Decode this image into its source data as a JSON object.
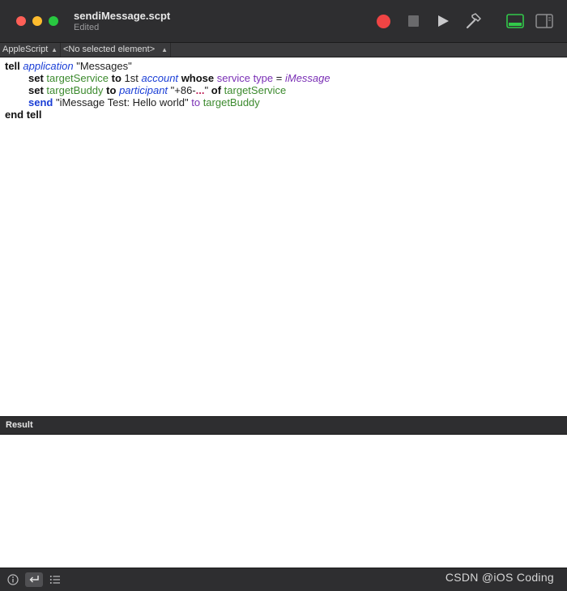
{
  "window": {
    "title": "sendiMessage.scpt",
    "subtitle": "Edited"
  },
  "toolbar": {
    "record_icon": "record-icon",
    "stop_icon": "stop-icon",
    "run_icon": "play-icon",
    "compile_icon": "hammer-icon",
    "log_icon": "log-panel-icon",
    "inspector_icon": "sidebar-icon",
    "accent": "#28c840",
    "record_color": "#ef4444"
  },
  "navbar": {
    "language": "AppleScript",
    "element": "<No selected element>"
  },
  "code": {
    "lines": [
      {
        "indent": false,
        "tokens": [
          {
            "text": "tell",
            "cls": "kw"
          },
          {
            "text": " ",
            "cls": "plain"
          },
          {
            "text": "application",
            "cls": "class"
          },
          {
            "text": " ",
            "cls": "plain"
          },
          {
            "text": "\"Messages\"",
            "cls": "str"
          }
        ]
      },
      {
        "indent": true,
        "tokens": [
          {
            "text": "set",
            "cls": "kw"
          },
          {
            "text": " ",
            "cls": "plain"
          },
          {
            "text": "targetService",
            "cls": "var"
          },
          {
            "text": " ",
            "cls": "plain"
          },
          {
            "text": "to",
            "cls": "kw"
          },
          {
            "text": " ",
            "cls": "plain"
          },
          {
            "text": "1st",
            "cls": "num"
          },
          {
            "text": " ",
            "cls": "plain"
          },
          {
            "text": "account",
            "cls": "class"
          },
          {
            "text": " ",
            "cls": "plain"
          },
          {
            "text": "whose",
            "cls": "kw"
          },
          {
            "text": " ",
            "cls": "plain"
          },
          {
            "text": "service type",
            "cls": "prop"
          },
          {
            "text": " = ",
            "cls": "plain"
          },
          {
            "text": "iMessage",
            "cls": "enum"
          }
        ]
      },
      {
        "indent": true,
        "tokens": [
          {
            "text": "set",
            "cls": "kw"
          },
          {
            "text": " ",
            "cls": "plain"
          },
          {
            "text": "targetBuddy",
            "cls": "var"
          },
          {
            "text": " ",
            "cls": "plain"
          },
          {
            "text": "to",
            "cls": "kw"
          },
          {
            "text": " ",
            "cls": "plain"
          },
          {
            "text": "participant",
            "cls": "class"
          },
          {
            "text": " ",
            "cls": "plain"
          },
          {
            "text": "\"+86-",
            "cls": "str"
          },
          {
            "text": "...",
            "cls": "hl"
          },
          {
            "text": "\"",
            "cls": "str"
          },
          {
            "text": " ",
            "cls": "plain"
          },
          {
            "text": "of",
            "cls": "kw"
          },
          {
            "text": " ",
            "cls": "plain"
          },
          {
            "text": "targetService",
            "cls": "var"
          }
        ]
      },
      {
        "indent": true,
        "tokens": [
          {
            "text": "send",
            "cls": "kwsend"
          },
          {
            "text": " ",
            "cls": "plain"
          },
          {
            "text": "\"iMessage Test: Hello world\"",
            "cls": "str"
          },
          {
            "text": " ",
            "cls": "plain"
          },
          {
            "text": "to",
            "cls": "prop2"
          },
          {
            "text": " ",
            "cls": "plain"
          },
          {
            "text": "targetBuddy",
            "cls": "var"
          }
        ]
      },
      {
        "indent": false,
        "tokens": [
          {
            "text": "end tell",
            "cls": "kw"
          }
        ]
      }
    ]
  },
  "result": {
    "title": "Result"
  },
  "bottombar": {
    "info_icon": "info-icon",
    "return_icon": "return-arrow-icon",
    "list_icon": "list-icon",
    "watermark": "CSDN @iOS Coding"
  }
}
